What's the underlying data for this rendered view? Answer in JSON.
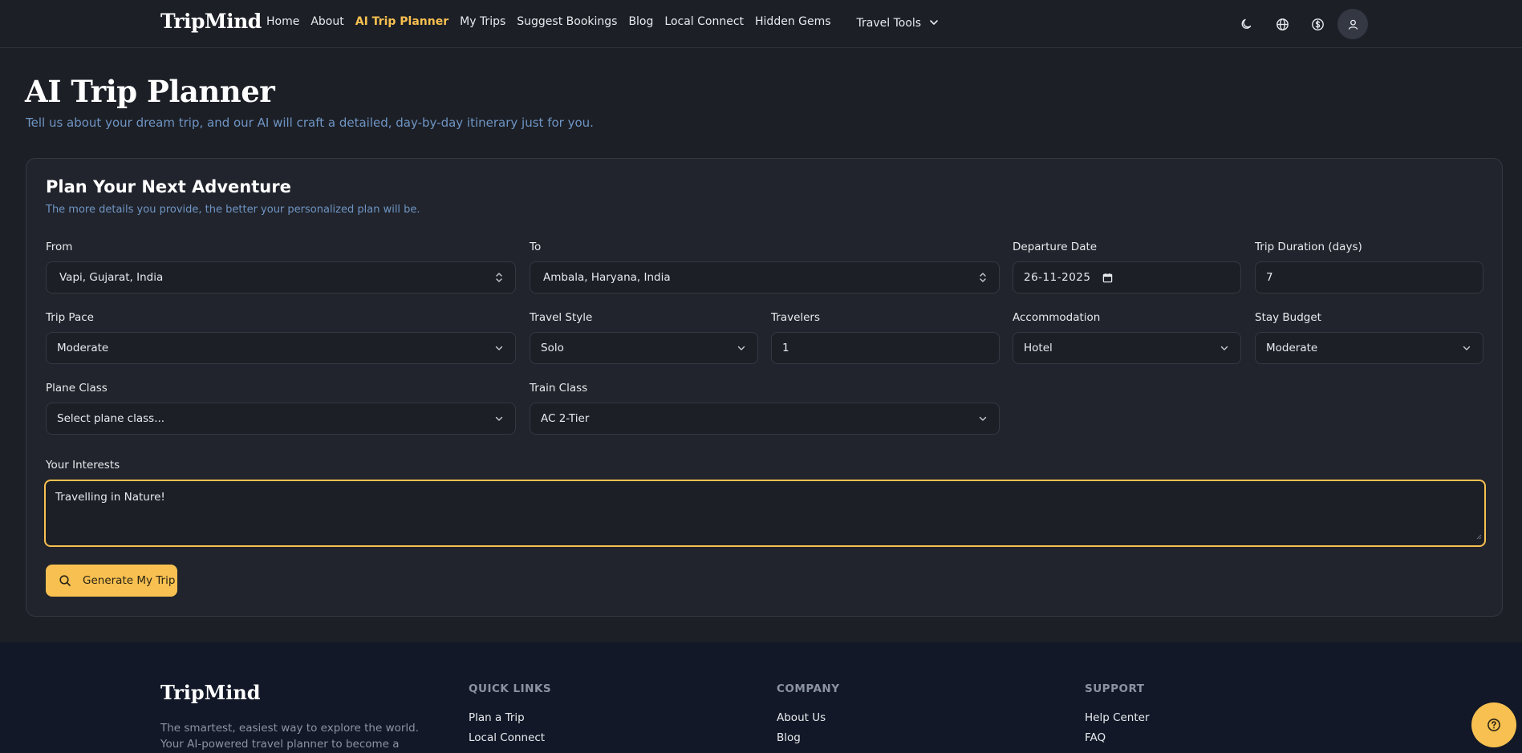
{
  "header": {
    "brand": "TripMind",
    "nav": [
      {
        "label": "Home"
      },
      {
        "label": "About"
      },
      {
        "label": "AI Trip Planner"
      },
      {
        "label": "My Trips"
      },
      {
        "label": "Suggest Bookings"
      },
      {
        "label": "Blog"
      },
      {
        "label": "Local Connect"
      },
      {
        "label": "Hidden Gems"
      }
    ],
    "tools_label": "Travel Tools",
    "icons": [
      "moon-icon",
      "globe-icon",
      "dollar-icon",
      "user-icon"
    ]
  },
  "page": {
    "title": "AI Trip Planner",
    "subtitle": "Tell us about your dream trip, and our AI will craft a detailed, day-by-day itinerary just for you."
  },
  "form": {
    "title": "Plan Your Next Adventure",
    "subtitle": "The more details you provide, the better your personalized plan will be.",
    "from": {
      "label": "From",
      "value": "Vapi, Gujarat, India"
    },
    "to": {
      "label": "To",
      "value": "Ambala, Haryana, India"
    },
    "departure": {
      "label": "Departure Date",
      "value": "26-11-2025"
    },
    "duration": {
      "label": "Trip Duration (days)",
      "value": "7"
    },
    "pace": {
      "label": "Trip Pace",
      "value": "Moderate"
    },
    "style": {
      "label": "Travel Style",
      "value": "Solo"
    },
    "travelers": {
      "label": "Travelers",
      "value": "1"
    },
    "accommodation": {
      "label": "Accommodation",
      "value": "Hotel"
    },
    "budget": {
      "label": "Stay Budget",
      "value": "Moderate"
    },
    "plane": {
      "label": "Plane Class",
      "value": "Select plane class..."
    },
    "train": {
      "label": "Train Class",
      "value": "AC 2-Tier"
    },
    "interests": {
      "label": "Your Interests",
      "value": "Travelling in Nature!"
    },
    "submit_label": "Generate My Trip"
  },
  "footer": {
    "brand": "TripMind",
    "description": "The smartest, easiest way to explore the world. Your AI-powered travel planner to become a conscious traveler.",
    "quick_links": {
      "heading": "QUICK LINKS",
      "links": [
        "Plan a Trip",
        "Local Connect"
      ]
    },
    "company": {
      "heading": "COMPANY",
      "links": [
        "About Us",
        "Blog"
      ]
    },
    "support": {
      "heading": "SUPPORT",
      "links": [
        "Help Center",
        "FAQ"
      ]
    }
  },
  "colors": {
    "accent": "#f7c050",
    "background": "#1c1f26",
    "card": "#21242c",
    "footer": "#121827",
    "muted_blue": "#6f95c4"
  }
}
